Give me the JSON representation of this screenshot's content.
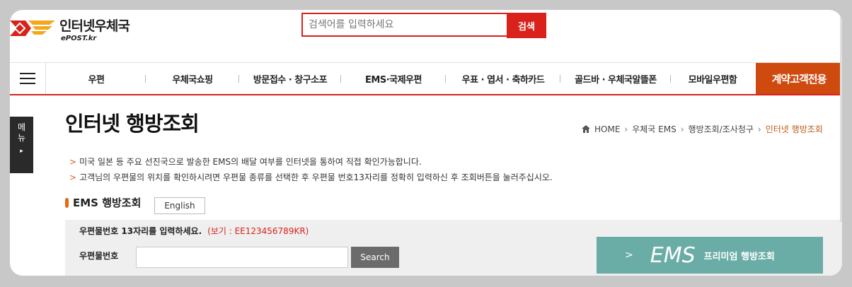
{
  "header": {
    "logo_title": "인터넷우체국",
    "logo_sub": "ePOST.kr",
    "search_placeholder": "검색어를 입력하세요",
    "search_button": "검색"
  },
  "nav": {
    "items": [
      "우편",
      "우체국쇼핑",
      "방문접수 · 창구소포",
      "EMS·국제우편",
      "우표 · 엽서 · 축하카드",
      "골드바 · 우체국알뜰폰",
      "모바일우편함"
    ],
    "contract": "계약고객전용"
  },
  "side_tab": {
    "line1": "메",
    "line2": "뉴",
    "arrow": "▸"
  },
  "page": {
    "title": "인터넷 행방조회",
    "breadcrumb": [
      "HOME",
      "우체국 EMS",
      "행방조회/조사청구",
      "인터넷 행방조회"
    ],
    "notes": [
      "미국 일본 등 주요 선진국으로 발송한 EMS의 배달 여부를 인터넷을 통하여 직접 확인가능합니다.",
      "고객님의 우편물의 위치를 확인하시려면 우편물 종류를 선택한 후 우편물 번호13자리를 정확히 입력하신 후 조회버튼을 눌러주십시오."
    ]
  },
  "section": {
    "title": "EMS 행방조회",
    "english_button": "English",
    "guide": "우편물번호 13자리를 입력하세요.",
    "example": "(보기 : EE123456789KR)",
    "field_label": "우편물번호",
    "search_button": "Search",
    "premium_big": "EMS",
    "premium_small": "프리미엄 행방조회",
    "premium_chevron": ">"
  },
  "colors": {
    "accent_red": "#d9221b",
    "contract_orange": "#cf4a0f",
    "premium_teal": "#6aada6"
  }
}
